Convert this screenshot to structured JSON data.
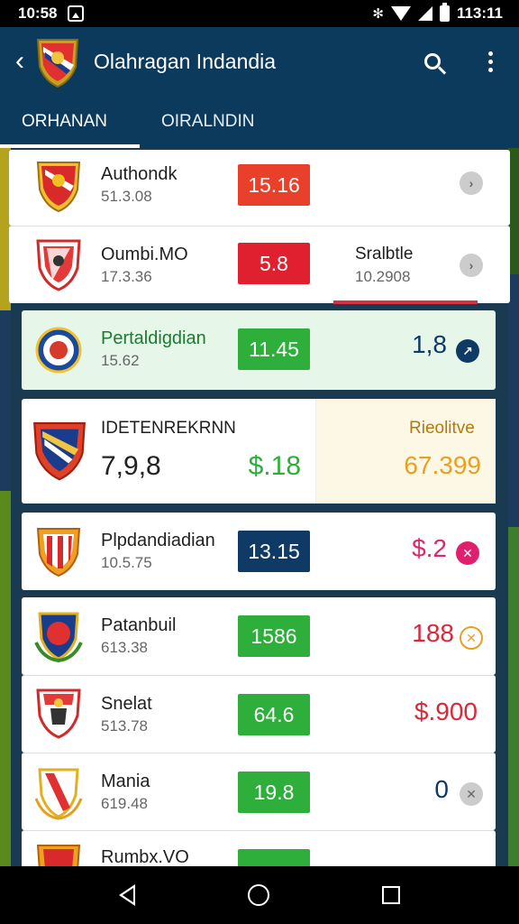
{
  "status": {
    "time": "10:58",
    "battery_time": "113:11"
  },
  "appbar": {
    "title": "Olahragan Indandia"
  },
  "tabs": [
    {
      "label": "ORHANAN"
    },
    {
      "label": "OIRALNDIN"
    }
  ],
  "matches": [
    {
      "team": "Authondk",
      "sub": "51.3.08",
      "score": "15.16",
      "score_color": "#e8402a"
    },
    {
      "team": "Oumbi.MO",
      "sub": "17.3.36",
      "score": "5.8",
      "score_color": "#e0202f",
      "side_title": "Sralbtle",
      "side_sub": "10.2908"
    },
    {
      "team": "Pertaldigdian",
      "sub": "15.62",
      "score": "11.45",
      "score_color": "#2eae3b",
      "value": "1,8"
    },
    {
      "team": "IDETENREKRNN",
      "big_left": "7,9,8",
      "score": "$.18",
      "right_title": "Rieolitve",
      "right_value": "67.399"
    },
    {
      "team": "Plpdandiadian",
      "sub": "10.5.75",
      "score": "13.15",
      "score_color": "#103a66",
      "value": "$.2"
    },
    {
      "team": "Patanbuil",
      "sub": "613.38",
      "score": "1586",
      "score_color": "#2eae3b",
      "value": "188"
    },
    {
      "team": "Snelat",
      "sub": "513.78",
      "score": "64.6",
      "score_color": "#2eae3b",
      "value": "$.900"
    },
    {
      "team": "Mania",
      "sub": "619.48",
      "score": "19.8",
      "score_color": "#2eae3b",
      "value": "0"
    },
    {
      "team": "Rumbx.VO"
    }
  ]
}
